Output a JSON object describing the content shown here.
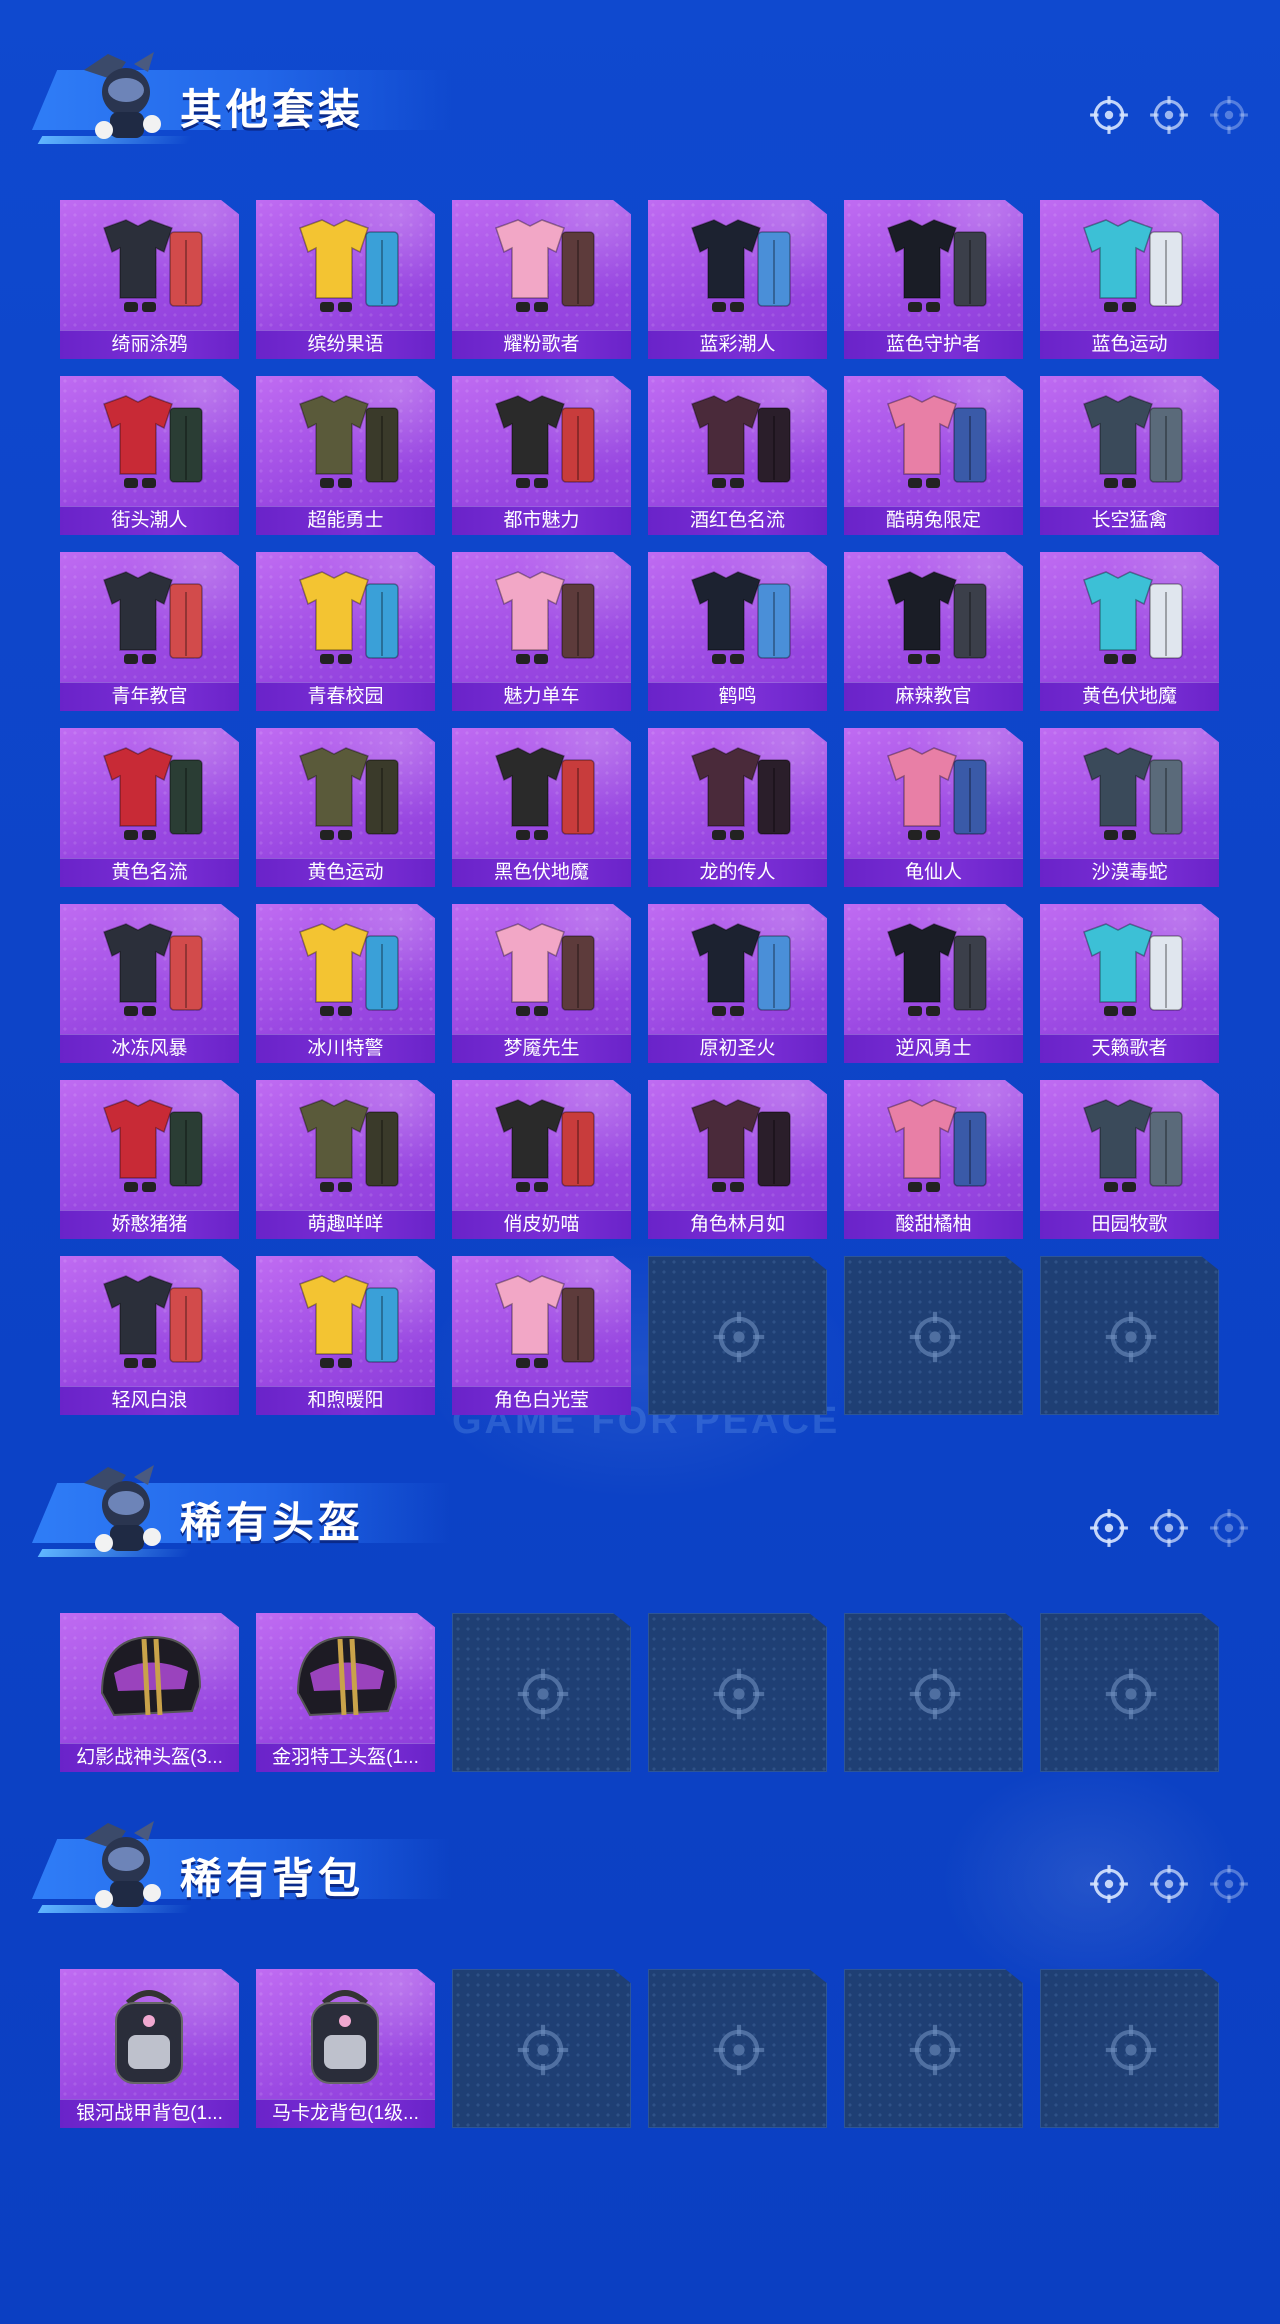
{
  "sections": [
    {
      "title": "其他套装",
      "items": [
        "绮丽涂鸦",
        "缤纷果语",
        "耀粉歌者",
        "蓝彩潮人",
        "蓝色守护者",
        "蓝色运动",
        "街头潮人",
        "超能勇士",
        "都市魅力",
        "酒红色名流",
        "酷萌兔限定",
        "长空猛禽",
        "青年教官",
        "青春校园",
        "魅力单车",
        "鹤鸣",
        "麻辣教官",
        "黄色伏地魔",
        "黄色名流",
        "黄色运动",
        "黑色伏地魔",
        "龙的传人",
        "龟仙人",
        "沙漠毒蛇",
        "冰冻风暴",
        "冰川特警",
        "梦魇先生",
        "原初圣火",
        "逆风勇士",
        "天籁歌者",
        "娇憨猪猪",
        "萌趣咩咩",
        "俏皮奶喵",
        "角色林月如",
        "酸甜橘柚",
        "田园牧歌",
        "轻风白浪",
        "和煦暖阳",
        "角色白光莹"
      ],
      "empty_slots": 3
    },
    {
      "title": "稀有头盔",
      "items": [
        "幻影战神头盔(3...",
        "金羽特工头盔(1..."
      ],
      "empty_slots": 4
    },
    {
      "title": "稀有背包",
      "items": [
        "银河战甲背包(1...",
        "马卡龙背包(1级..."
      ],
      "empty_slots": 4
    }
  ],
  "watermark": "GAME FOR PEACE",
  "colors": {
    "background": "#0f49cf",
    "card_filled": "#a653e6",
    "card_label": "#7b2fd6",
    "card_empty": "#1f3f74",
    "title_text": "#ffffff"
  },
  "icons": {
    "header_icons": [
      "crosshair-icon",
      "crosshair-icon",
      "crosshair-icon"
    ],
    "empty_slot_icon": "crosshair-icon",
    "mascot": "soldier-mascot-icon"
  }
}
